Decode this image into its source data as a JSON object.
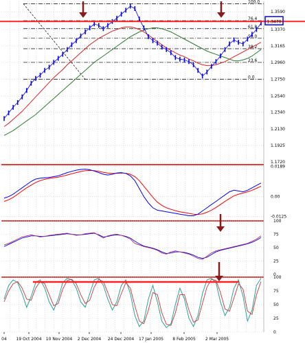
{
  "colors": {
    "background": "#ffffff",
    "grid": "#c8c8c8",
    "frame": "#cc0000",
    "price": "#0000ff",
    "ma_fast": "#e02020",
    "ma_slow": "#2e7d2e",
    "arrow": "#8b1a1a",
    "resistance": "#ff2020",
    "stoch_k": "#2aa198",
    "stoch_d": "#cc3333",
    "rsi_main": "#b03060",
    "rsi_signal": "#0000ff",
    "macd": "#0000ff",
    "signal": "#ff0000",
    "highlight_box": "#0000ff"
  },
  "chart_data": [
    {
      "type": "line",
      "panel": "price",
      "yticks": [
        "1.3590",
        "1.3370",
        "1.3165",
        "1.2960",
        "1.2750",
        "1.2540",
        "1.2340",
        "1.2130",
        "1.1925",
        "1.1720"
      ],
      "fib_levels": [
        {
          "label": "100.0",
          "value": 1.369
        },
        {
          "label": "76.4",
          "value": 1.348
        },
        {
          "label": "61.8",
          "value": 1.338
        },
        {
          "label": "50.0",
          "value": 1.326
        },
        {
          "label": "38.2",
          "value": 1.313
        },
        {
          "label": "23.6",
          "value": 1.296
        },
        {
          "label": "0.0",
          "value": 1.275
        }
      ],
      "current_price_label": "1.3470",
      "resistance_level": 1.347,
      "ylim": [
        1.172,
        1.372
      ],
      "series": [
        {
          "role": "price",
          "values": [
            1.226,
            1.233,
            1.24,
            1.246,
            1.253,
            1.261,
            1.27,
            1.276,
            1.28,
            1.286,
            1.29,
            1.296,
            1.301,
            1.306,
            1.312,
            1.318,
            1.323,
            1.329,
            1.334,
            1.339,
            1.344,
            1.342,
            1.338,
            1.342,
            1.347,
            1.351,
            1.356,
            1.361,
            1.366,
            1.363,
            1.35,
            1.339,
            1.328,
            1.323,
            1.32,
            1.315,
            1.312,
            1.308,
            1.302,
            1.3,
            1.299,
            1.297,
            1.293,
            1.286,
            1.279,
            1.284,
            1.291,
            1.297,
            1.304,
            1.312,
            1.319,
            1.324,
            1.321,
            1.319,
            1.325,
            1.331,
            1.337,
            1.345
          ]
        },
        {
          "role": "ma-fast",
          "values": [
            1.216,
            1.22,
            1.225,
            1.23,
            1.235,
            1.241,
            1.247,
            1.253,
            1.259,
            1.265,
            1.271,
            1.277,
            1.282,
            1.287,
            1.293,
            1.298,
            1.303,
            1.308,
            1.313,
            1.318,
            1.322,
            1.326,
            1.329,
            1.332,
            1.335,
            1.337,
            1.339,
            1.34,
            1.34,
            1.339,
            1.337,
            1.334,
            1.33,
            1.326,
            1.322,
            1.318,
            1.314,
            1.311,
            1.308,
            1.305,
            1.303,
            1.3,
            1.298,
            1.295,
            1.293,
            1.292,
            1.292,
            1.293,
            1.295,
            1.297,
            1.3,
            1.303,
            1.306,
            1.309,
            1.312,
            1.315,
            1.318,
            1.321
          ]
        },
        {
          "role": "ma-slow",
          "values": [
            1.205,
            1.208,
            1.211,
            1.215,
            1.219,
            1.223,
            1.227,
            1.231,
            1.236,
            1.241,
            1.246,
            1.251,
            1.256,
            1.261,
            1.266,
            1.271,
            1.276,
            1.281,
            1.286,
            1.291,
            1.296,
            1.3,
            1.304,
            1.308,
            1.312,
            1.316,
            1.32,
            1.324,
            1.328,
            1.331,
            1.334,
            1.336,
            1.338,
            1.339,
            1.339,
            1.338,
            1.336,
            1.334,
            1.331,
            1.328,
            1.325,
            1.322,
            1.319,
            1.316,
            1.313,
            1.31,
            1.308,
            1.306,
            1.304,
            1.302,
            1.3,
            1.298,
            1.298,
            1.299,
            1.301,
            1.304,
            1.308,
            1.312
          ]
        }
      ]
    },
    {
      "type": "line",
      "panel": "macd",
      "yticks": [
        "0.0189",
        "0.00",
        "-0.0125"
      ],
      "ylim": [
        -0.0135,
        0.02
      ],
      "series": [
        {
          "role": "macd",
          "values": [
            -0.001,
            0.0,
            0.0015,
            0.0035,
            0.0055,
            0.0075,
            0.0095,
            0.011,
            0.0115,
            0.0118,
            0.012,
            0.0125,
            0.013,
            0.014,
            0.015,
            0.0158,
            0.0165,
            0.017,
            0.0172,
            0.0168,
            0.016,
            0.015,
            0.014,
            0.0135,
            0.014,
            0.0148,
            0.015,
            0.0145,
            0.013,
            0.01,
            0.005,
            0.0,
            -0.004,
            -0.007,
            -0.0085,
            -0.009,
            -0.0095,
            -0.01,
            -0.0105,
            -0.011,
            -0.0115,
            -0.012,
            -0.012,
            -0.011,
            -0.009,
            -0.007,
            -0.005,
            -0.003,
            -0.001,
            0.001,
            0.003,
            0.004,
            0.0035,
            0.003,
            0.004,
            0.0055,
            0.007,
            0.0085
          ]
        },
        {
          "role": "signal",
          "values": [
            -0.003,
            -0.002,
            -0.0005,
            0.0015,
            0.0035,
            0.0055,
            0.0072,
            0.0088,
            0.01,
            0.0108,
            0.0114,
            0.0118,
            0.0122,
            0.0128,
            0.0135,
            0.0143,
            0.015,
            0.0157,
            0.0162,
            0.0164,
            0.0162,
            0.0158,
            0.0152,
            0.0147,
            0.0145,
            0.0146,
            0.0147,
            0.0146,
            0.014,
            0.0125,
            0.01,
            0.0065,
            0.003,
            -0.0005,
            -0.0035,
            -0.0055,
            -0.007,
            -0.008,
            -0.0088,
            -0.0095,
            -0.01,
            -0.0105,
            -0.011,
            -0.0112,
            -0.0108,
            -0.0098,
            -0.0085,
            -0.0068,
            -0.005,
            -0.003,
            -0.0012,
            0.0005,
            0.0015,
            0.0022,
            0.003,
            0.004,
            0.0052,
            0.0065
          ]
        }
      ]
    },
    {
      "type": "line",
      "panel": "rsi",
      "yticks": [
        "100",
        "75",
        "50",
        "25",
        "0"
      ],
      "ylim": [
        0,
        100
      ],
      "series": [
        {
          "role": "rsi",
          "values": [
            55,
            58,
            62,
            66,
            70,
            72,
            74,
            72,
            70,
            71,
            73,
            74,
            75,
            76,
            77,
            75,
            73,
            74,
            76,
            77,
            78,
            73,
            68,
            72,
            74,
            75,
            73,
            70,
            66,
            58,
            55,
            52,
            50,
            48,
            45,
            40,
            38,
            42,
            44,
            42,
            40,
            38,
            34,
            30,
            28,
            34,
            40,
            44,
            46,
            48,
            50,
            52,
            54,
            56,
            58,
            62,
            66,
            72
          ]
        },
        {
          "role": "rsi-signal",
          "values": [
            52,
            56,
            60,
            64,
            68,
            70,
            72,
            72,
            71,
            71,
            72,
            73,
            74,
            75,
            76,
            75,
            74,
            74,
            75,
            76,
            77,
            74,
            70,
            71,
            73,
            74,
            73,
            71,
            68,
            62,
            57,
            53,
            51,
            49,
            46,
            42,
            39,
            40,
            42,
            42,
            41,
            39,
            36,
            32,
            30,
            32,
            37,
            42,
            45,
            47,
            49,
            51,
            53,
            55,
            57,
            60,
            64,
            69
          ]
        }
      ]
    },
    {
      "type": "line",
      "panel": "stochastic",
      "yticks": [
        "100",
        "75",
        "50",
        "25",
        "0"
      ],
      "ylim": [
        0,
        100
      ],
      "resistance_level": 100,
      "xticks": [
        "04",
        "19 Oct 2004",
        "10 Nov 2004",
        "2 Dec 2004",
        "24 Dec 2004",
        "17 Jan 2005",
        "8 Feb 2005",
        "2 Mar 2005"
      ],
      "series": [
        {
          "role": "stoch-k",
          "values": [
            60,
            85,
            95,
            90,
            70,
            45,
            65,
            90,
            95,
            80,
            55,
            40,
            60,
            90,
            98,
            95,
            80,
            55,
            45,
            70,
            95,
            98,
            85,
            60,
            40,
            55,
            85,
            95,
            70,
            30,
            10,
            20,
            60,
            85,
            55,
            20,
            8,
            15,
            50,
            80,
            60,
            25,
            10,
            30,
            70,
            95,
            98,
            90,
            55,
            30,
            45,
            80,
            95,
            65,
            20,
            40,
            85,
            98
          ]
        },
        {
          "role": "stoch-d",
          "values": [
            55,
            75,
            88,
            92,
            80,
            60,
            58,
            80,
            92,
            88,
            68,
            48,
            52,
            78,
            94,
            96,
            88,
            68,
            52,
            58,
            82,
            96,
            92,
            72,
            50,
            48,
            70,
            90,
            80,
            48,
            20,
            15,
            40,
            72,
            68,
            35,
            14,
            12,
            35,
            68,
            68,
            40,
            18,
            22,
            52,
            82,
            96,
            94,
            72,
            42,
            38,
            62,
            88,
            78,
            38,
            32,
            68,
            92
          ]
        }
      ]
    }
  ]
}
